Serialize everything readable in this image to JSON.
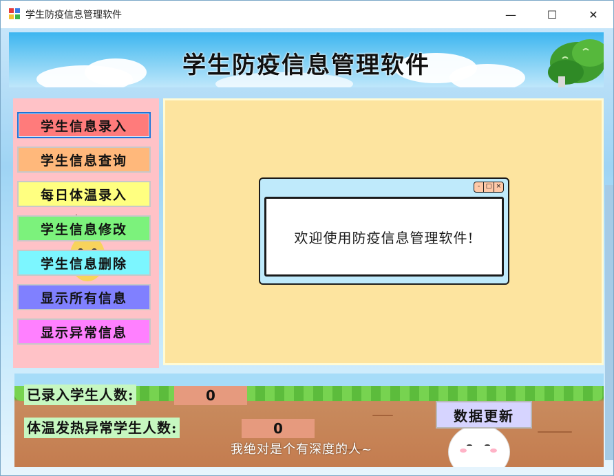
{
  "window": {
    "title": "学生防疫信息管理软件",
    "controls": {
      "minimize": "—",
      "maximize": "☐",
      "close": "✕"
    }
  },
  "banner": {
    "title": "学生防疫信息管理软件"
  },
  "menu": {
    "items": [
      {
        "label": "学生信息录入",
        "color": "#ff7b7b",
        "active": true
      },
      {
        "label": "学生信息查询",
        "color": "#ffb87b",
        "active": false
      },
      {
        "label": "每日体温录入",
        "color": "#ffff80",
        "active": false
      },
      {
        "label": "学生信息修改",
        "color": "#7cf27c",
        "active": false
      },
      {
        "label": "学生信息删除",
        "color": "#7cf6ff",
        "active": false
      },
      {
        "label": "显示所有信息",
        "color": "#8080ff",
        "active": false
      },
      {
        "label": "显示异常信息",
        "color": "#ff80ff",
        "active": false
      }
    ]
  },
  "dialog": {
    "message": "欢迎使用防疫信息管理软件!",
    "controls": [
      "-",
      "□",
      "×"
    ]
  },
  "stats": {
    "enrolled_label": "已录入学生人数:",
    "enrolled_value": "0",
    "fever_label": "体温发热异常学生人数:",
    "fever_value": "0",
    "update_button": "数据更新",
    "motto": "我绝对是个有深度的人~"
  },
  "colors": {
    "banner": "#3db5f0",
    "menu_bg": "#ffc2c7",
    "main_bg": "#fde49f",
    "label_bg": "#c6f7c0",
    "value_bg": "#e69a7e",
    "update_bg": "#d6d4ff"
  }
}
